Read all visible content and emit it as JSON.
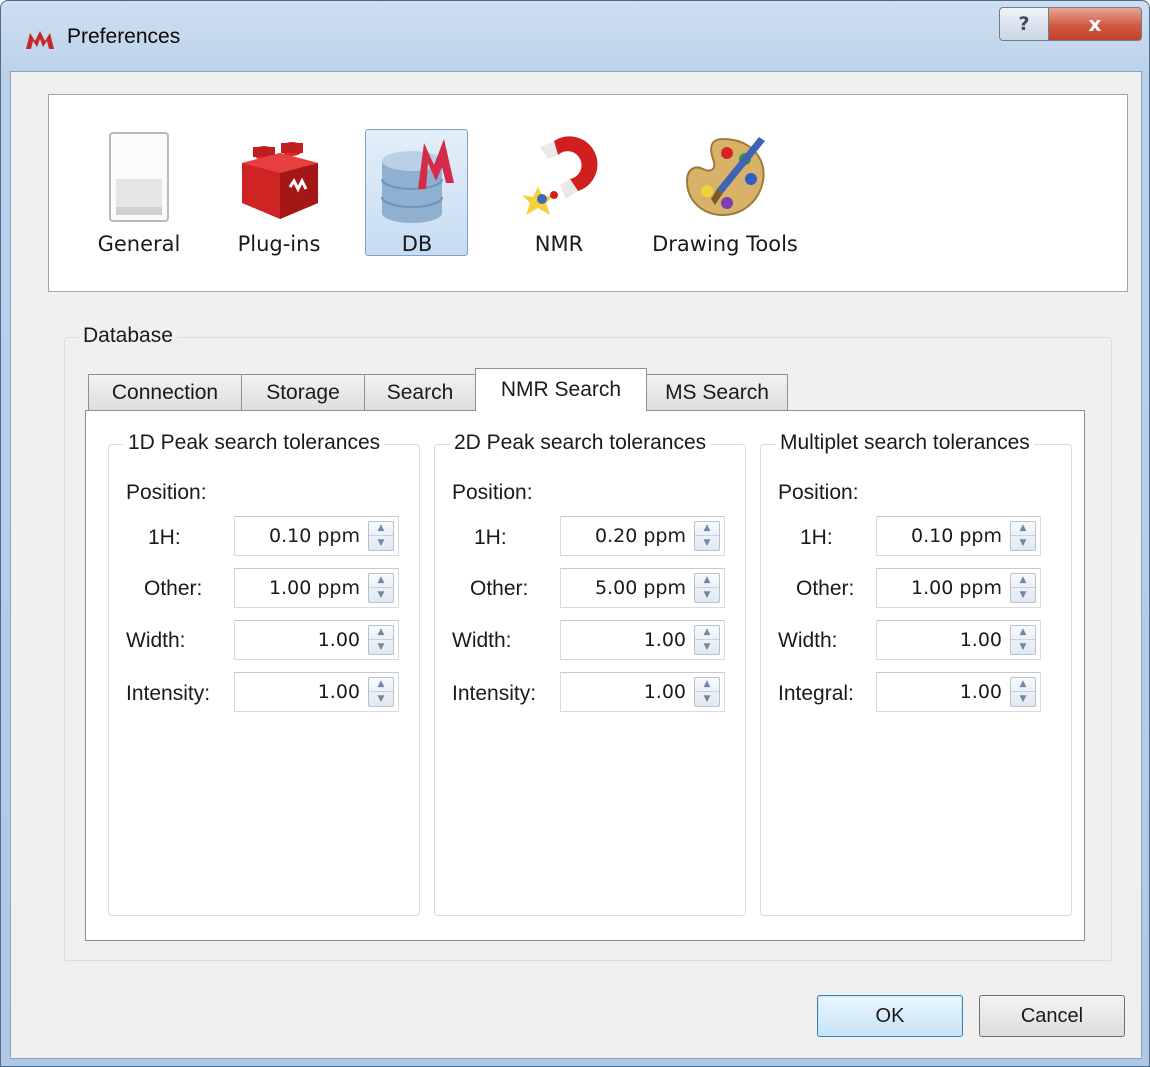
{
  "window": {
    "title": "Preferences",
    "help_glyph": "?",
    "close_glyph": "x"
  },
  "categories": [
    {
      "label": "General",
      "icon": "general-page-icon",
      "selected": false
    },
    {
      "label": "Plug-ins",
      "icon": "plugin-brick-icon",
      "selected": false
    },
    {
      "label": "DB",
      "icon": "database-icon",
      "selected": true
    },
    {
      "label": "NMR",
      "icon": "magnet-icon",
      "selected": false
    },
    {
      "label": "Drawing Tools",
      "icon": "palette-icon",
      "selected": false
    }
  ],
  "database": {
    "title": "Database",
    "tabs": [
      {
        "label": "Connection",
        "active": false
      },
      {
        "label": "Storage",
        "active": false
      },
      {
        "label": "Search",
        "active": false
      },
      {
        "label": "NMR Search",
        "active": true
      },
      {
        "label": "MS Search",
        "active": false
      }
    ],
    "groups": [
      {
        "title": "1D Peak search tolerances",
        "position_label": "Position:",
        "fields": [
          {
            "label": "1H:",
            "value": "0.10 ppm"
          },
          {
            "label": "Other:",
            "value": "1.00 ppm"
          },
          {
            "label": "Width:",
            "value": "1.00"
          },
          {
            "label": "Intensity:",
            "value": "1.00"
          }
        ]
      },
      {
        "title": "2D Peak search tolerances",
        "position_label": "Position:",
        "fields": [
          {
            "label": "1H:",
            "value": "0.20 ppm"
          },
          {
            "label": "Other:",
            "value": "5.00 ppm"
          },
          {
            "label": "Width:",
            "value": "1.00"
          },
          {
            "label": "Intensity:",
            "value": "1.00"
          }
        ]
      },
      {
        "title": "Multiplet search tolerances",
        "position_label": "Position:",
        "fields": [
          {
            "label": "1H:",
            "value": "0.10 ppm"
          },
          {
            "label": "Other:",
            "value": "1.00 ppm"
          },
          {
            "label": "Width:",
            "value": "1.00"
          },
          {
            "label": "Integral:",
            "value": "1.00"
          }
        ]
      }
    ]
  },
  "buttons": {
    "ok_label": "OK",
    "cancel_label": "Cancel"
  },
  "colors": {
    "accent": "#c6dcf3",
    "close_button": "#cf5a43",
    "app_icon": "#c0282c"
  }
}
